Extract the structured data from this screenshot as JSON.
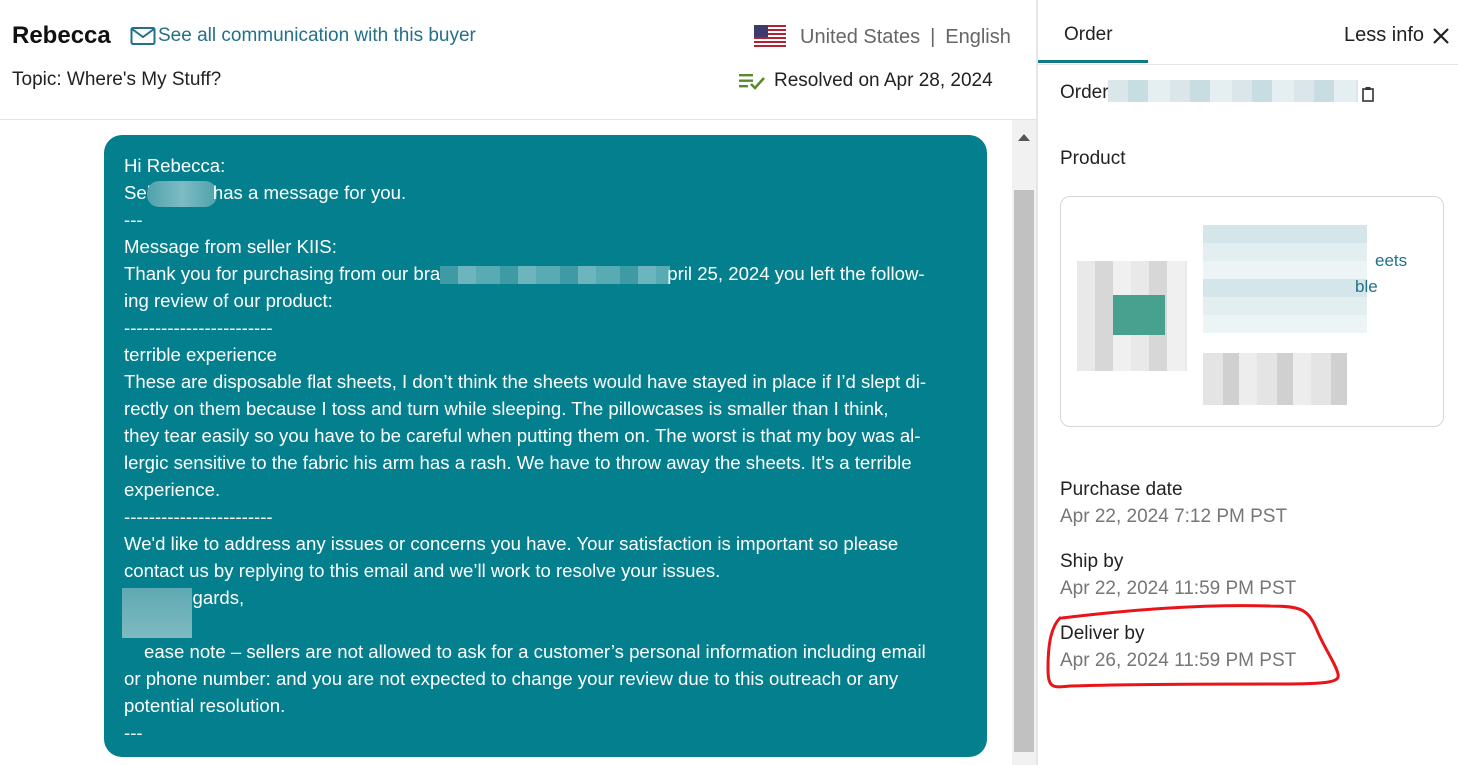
{
  "header": {
    "buyer_name": "Rebecca",
    "comm_link": "See all communication with this buyer",
    "country": "United States",
    "separator": "|",
    "language": "English",
    "topic": "Topic: Where's My Stuff?",
    "resolved": "Resolved on Apr 28, 2024"
  },
  "message": {
    "l1": "Hi Rebecca:",
    "l2_a": "Sel",
    "l2_b": "has a message for you.",
    "l3": "---",
    "l4": "Message from seller KIIS:",
    "l5_a": "Thank you for purchasing from our bra",
    "l5_b": "pril 25, 2024 you left the follow-",
    "l6": "ing review of our product:",
    "l7": "------------------------",
    "l8": "terrible experience",
    "l9": "These are disposable flat sheets, I don’t think the sheets would have stayed in place if I’d slept di-",
    "l10": "rectly on them because I toss and turn while sleeping. The pillowcases is smaller than I think,",
    "l11": "they tear easily so you have to be careful when putting them on. The worst is that my boy was al-",
    "l12": "lergic sensitive to the fabric his arm has a rash. We have to throw away the sheets. It's a terrible",
    "l13": "experience.",
    "l14": "------------------------",
    "l15": "We'd like to address any issues or concerns you have. Your satisfaction is important so please",
    "l16": "contact us by replying to this email and we’ll work to resolve your issues.",
    "l17": "regards,",
    "l18": "",
    "l19": "ease note – sellers are not allowed to ask for a customer’s personal information including email",
    "l20": "or phone number: and you are not expected to change your review due to this outreach or any",
    "l21": "potential resolution.",
    "l22": "---"
  },
  "panel": {
    "tab": "Order",
    "less_info": "Less info",
    "order_label": "Order",
    "product_label": "Product",
    "product_title_frag1": "eets",
    "product_title_frag2": "ble",
    "purchase_label": "Purchase date",
    "purchase_value": "Apr 22, 2024 7:12 PM PST",
    "ship_label": "Ship by",
    "ship_value": "Apr 22, 2024 11:59 PM PST",
    "deliver_label": "Deliver by",
    "deliver_value": "Apr 26, 2024 11:59 PM PST"
  },
  "icons": {
    "mail": "mail-icon",
    "flag": "us-flag-icon",
    "resolved": "resolved-list-check-icon",
    "close": "close-icon",
    "copy": "copy-icon",
    "scroll_up": "scroll-up-arrow-icon"
  },
  "colors": {
    "bubble": "#047f8e",
    "link": "#23708a",
    "annotation": "#e8141a"
  }
}
